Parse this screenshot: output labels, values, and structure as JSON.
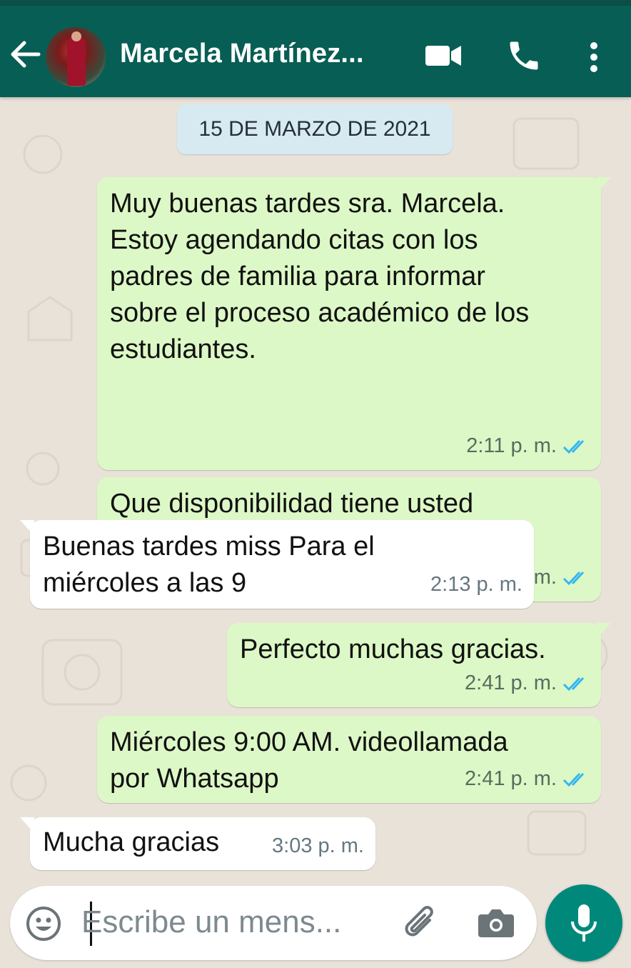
{
  "header": {
    "contact_name": "Marcela Martínez...",
    "icons": [
      "back-arrow-icon",
      "avatar",
      "video-call-icon",
      "phone-icon",
      "more-vert-icon"
    ]
  },
  "chat": {
    "date_chip": "15 DE MARZO DE 2021",
    "messages": [
      {
        "direction": "out",
        "text": "Muy buenas tardes sra. Marcela.\nEstoy agendando citas con los\npadres de familia para informar\nsobre el proceso académico de los\nestudiantes.",
        "time": "2:11 p. m.",
        "status": "read"
      },
      {
        "direction": "out",
        "text": "Que disponibilidad tiene usted\npara el día miércoles 9:00 AM. O a\nlas 12:30 pm",
        "time": "2:12 p. m.",
        "status": "read"
      },
      {
        "direction": "in",
        "text": "Buenas tardes miss Para el\nmiércoles a las 9",
        "time": "2:13 p. m."
      },
      {
        "direction": "out",
        "text": "Perfecto muchas gracias.",
        "time": "2:41 p. m.",
        "status": "read"
      },
      {
        "direction": "out",
        "text": "Miércoles 9:00 AM. videollamada\npor  Whatsapp",
        "time": "2:41 p. m.",
        "status": "read"
      },
      {
        "direction": "in",
        "text": "Mucha gracias",
        "time": "3:03 p. m."
      }
    ]
  },
  "composer": {
    "placeholder": "Escribe un mens...",
    "icons": [
      "emoji-icon",
      "attach-icon",
      "camera-icon",
      "mic-icon"
    ]
  },
  "colors": {
    "header": "#075e54",
    "outgoing_bubble": "#dcf8c6",
    "incoming_bubble": "#ffffff",
    "read_ticks": "#34b7f1",
    "mic_button": "#00897b"
  }
}
